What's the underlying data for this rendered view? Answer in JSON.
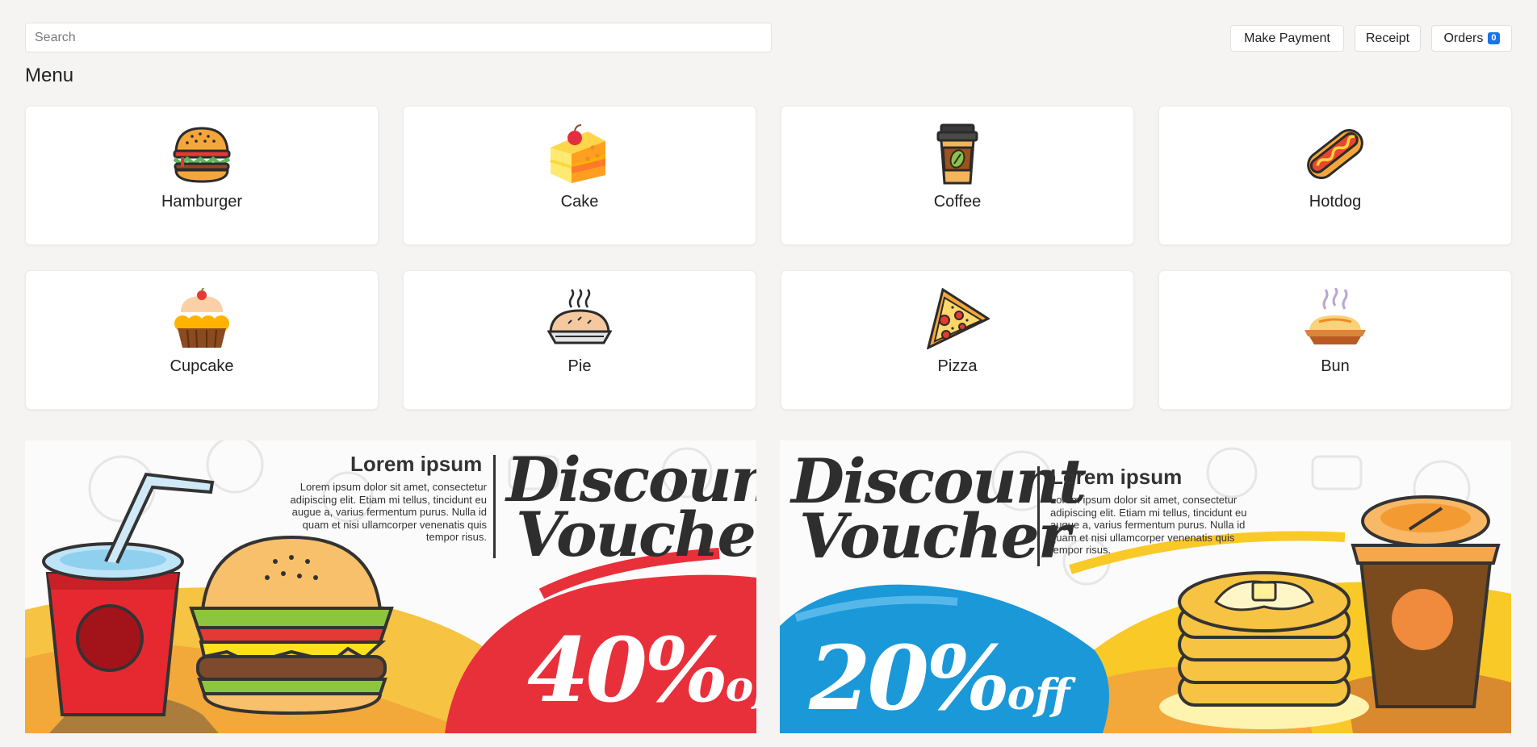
{
  "search": {
    "placeholder": "Search"
  },
  "actions": {
    "make_payment": "Make Payment",
    "receipt": "Receipt",
    "orders": "Orders",
    "orders_count": "0"
  },
  "menu": {
    "title": "Menu",
    "items": [
      {
        "label": "Hamburger",
        "icon": "hamburger-icon"
      },
      {
        "label": "Cake",
        "icon": "cake-icon"
      },
      {
        "label": "Coffee",
        "icon": "coffee-icon"
      },
      {
        "label": "Hotdog",
        "icon": "hotdog-icon"
      },
      {
        "label": "Cupcake",
        "icon": "cupcake-icon"
      },
      {
        "label": "Pie",
        "icon": "pie-icon"
      },
      {
        "label": "Pizza",
        "icon": "pizza-icon"
      },
      {
        "label": "Bun",
        "icon": "bun-icon"
      }
    ]
  },
  "banners": [
    {
      "heading": "Lorem ipsum",
      "body": "Lorem ipsum dolor sit amet, consectetur adipiscing elit. Etiam mi tellus, tincidunt eu augue a, varius fermentum purus. Nulla id quam et nisi ullamcorper venenatis quis tempor risus.",
      "title_line1": "Discount",
      "title_line2": "Voucher",
      "percent": "40%",
      "off": "off",
      "accent": "#e8303a"
    },
    {
      "heading": "Lorem ipsum",
      "body": "Lorem ipsum dolor sit amet, consectetur adipiscing elit. Etiam mi tellus, tincidunt eu augue a, varius fermentum purus. Nulla id quam et nisi ullamcorper venenatis quis tempor risus.",
      "title_line1": "Discount",
      "title_line2": "Voucher",
      "percent": "20%",
      "off": "off",
      "accent": "#1a98d8"
    }
  ]
}
